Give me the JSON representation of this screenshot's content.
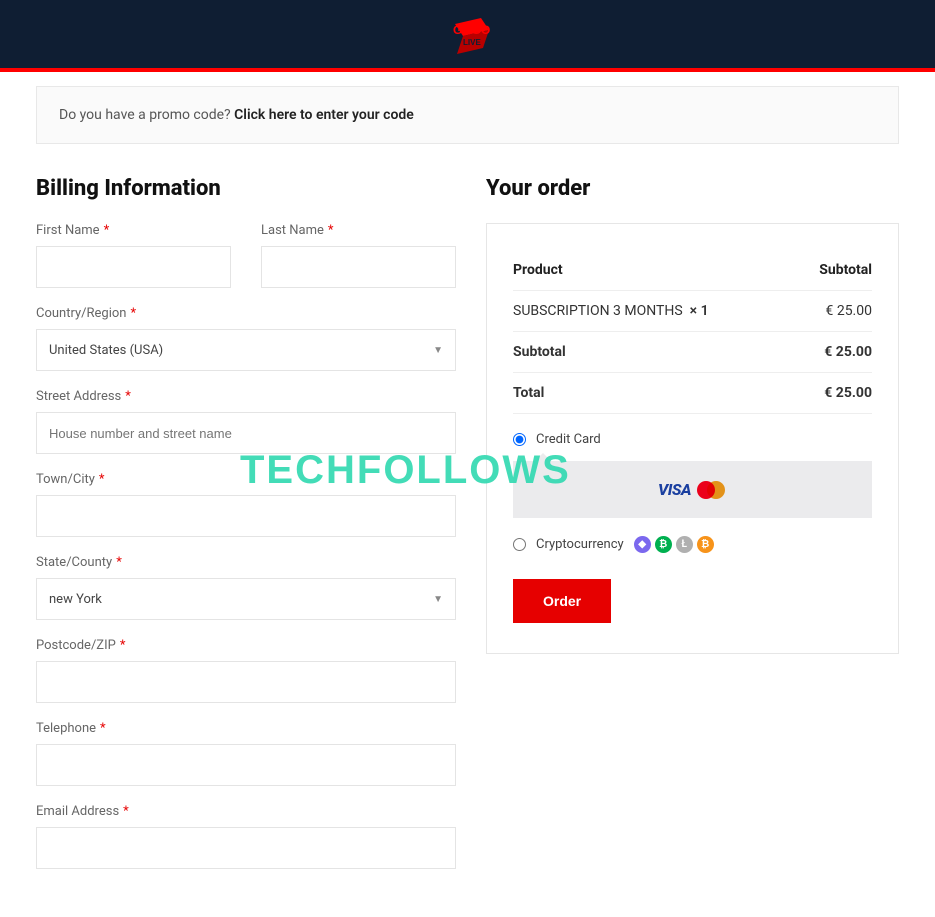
{
  "header": {
    "logo_top": "GOGO",
    "logo_bottom": "LIVE"
  },
  "promo": {
    "prefix": "Do you have a promo code? ",
    "link": "Click here to enter your code"
  },
  "billing": {
    "heading": "Billing Information",
    "first_name": {
      "label": "First Name",
      "value": ""
    },
    "last_name": {
      "label": "Last Name",
      "value": ""
    },
    "country": {
      "label": "Country/Region",
      "value": "United States (USA)"
    },
    "street": {
      "label": "Street Address",
      "placeholder": "House number and street name",
      "value": ""
    },
    "city": {
      "label": "Town/City",
      "value": ""
    },
    "state": {
      "label": "State/County",
      "value": "new York"
    },
    "zip": {
      "label": "Postcode/ZIP",
      "value": ""
    },
    "phone": {
      "label": "Telephone",
      "value": ""
    },
    "email": {
      "label": "Email Address",
      "value": ""
    }
  },
  "order": {
    "heading": "Your order",
    "cols": {
      "product": "Product",
      "subtotal": "Subtotal"
    },
    "item": {
      "name": "SUBSCRIPTION 3 MONTHS",
      "qty_label": "× 1",
      "price": "€ 25.00"
    },
    "subtotal": {
      "label": "Subtotal",
      "value": "€ 25.00"
    },
    "total": {
      "label": "Total",
      "value": "€ 25.00"
    },
    "pay_cc": "Credit Card",
    "pay_crypto": "Cryptocurrency",
    "button": "Order"
  },
  "watermark": "TECHFOLLOWS"
}
